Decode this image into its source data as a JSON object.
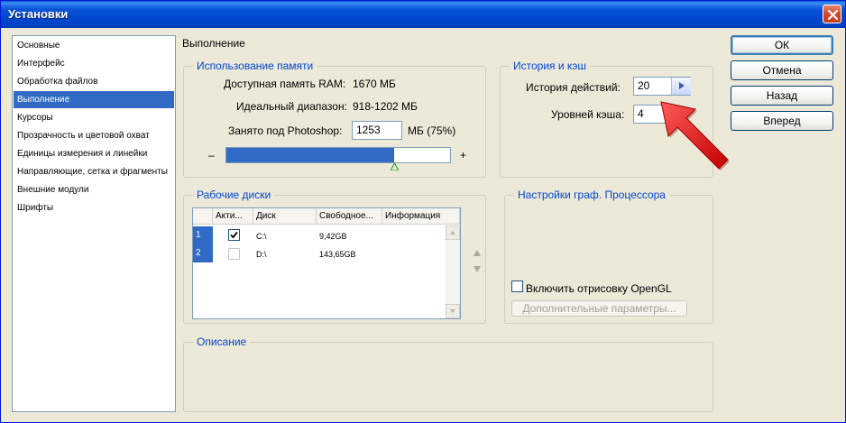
{
  "window": {
    "title": "Установки"
  },
  "nav": {
    "items": [
      {
        "label": "Основные"
      },
      {
        "label": "Интерфейс"
      },
      {
        "label": "Обработка файлов"
      },
      {
        "label": "Выполнение",
        "selected": true
      },
      {
        "label": "Курсоры"
      },
      {
        "label": "Прозрачность и цветовой охват"
      },
      {
        "label": "Единицы измерения и линейки"
      },
      {
        "label": "Направляющие, сетка и фрагменты"
      },
      {
        "label": "Внешние модули"
      },
      {
        "label": "Шрифты"
      }
    ]
  },
  "page": {
    "title": "Выполнение"
  },
  "memory": {
    "legend": "Использование памяти",
    "available_label": "Доступная память RAM:",
    "available_value": "1670 МБ",
    "ideal_label": "Идеальный диапазон:",
    "ideal_value": "918-1202 МБ",
    "used_label": "Занято под Photoshop:",
    "used_value": "1253",
    "used_unit": "МБ (75%)",
    "slider_min": "–",
    "slider_max": "+",
    "slider_percent": 75
  },
  "history": {
    "legend": "История и кэш",
    "history_label": "История действий:",
    "history_value": "20",
    "cache_label": "Уровней кэша:",
    "cache_value": "4"
  },
  "disks": {
    "legend": "Рабочие диски",
    "columns": [
      "Акти...",
      "Диск",
      "Свободное...",
      "Информация"
    ],
    "rows": [
      {
        "num": "1",
        "active": true,
        "disk": "C:\\",
        "free": "9,42GB",
        "info": ""
      },
      {
        "num": "2",
        "active": false,
        "disk": "D:\\",
        "free": "143,65GB",
        "info": ""
      }
    ]
  },
  "gpu": {
    "legend": "Настройки граф. Процессора",
    "opengl_label": "Включить отрисовку OpenGL",
    "advanced_label": "Дополнительные параметры..."
  },
  "description": {
    "legend": "Описание"
  },
  "buttons": {
    "ok": "ОК",
    "cancel": "Отмена",
    "back": "Назад",
    "forward": "Вперед"
  },
  "colors": {
    "accent": "#316ac5",
    "legend_text": "#0046d5",
    "annotation_arrow": "#e00000"
  }
}
